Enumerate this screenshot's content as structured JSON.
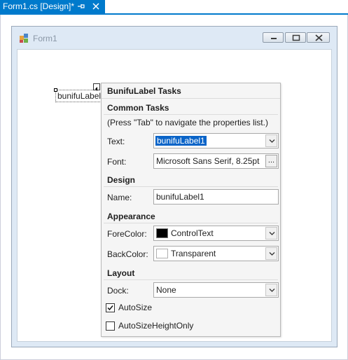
{
  "doc_tab": {
    "label": "Form1.cs [Design]*"
  },
  "form": {
    "title": "Form1"
  },
  "selected_control": {
    "text": "bunifuLabel"
  },
  "tasks": {
    "title": "BunifuLabel Tasks",
    "common": {
      "title": "Common Tasks",
      "hint": "(Press \"Tab\" to navigate the properties list.)",
      "text_label": "Text:",
      "text_value": "bunifuLabel1",
      "font_label": "Font:",
      "font_value": "Microsoft Sans Serif, 8.25pt",
      "font_button": "..."
    },
    "design": {
      "title": "Design",
      "name_label": "Name:",
      "name_value": "bunifuLabel1"
    },
    "appearance": {
      "title": "Appearance",
      "forecolor_label": "ForeColor:",
      "forecolor_value": "ControlText",
      "forecolor_swatch": "#000000",
      "backcolor_label": "BackColor:",
      "backcolor_value": "Transparent",
      "backcolor_swatch": "#ffffff"
    },
    "layout": {
      "title": "Layout",
      "dock_label": "Dock:",
      "dock_value": "None",
      "autosize_label": "AutoSize",
      "autosize_checked": true,
      "autosize_height_label": "AutoSizeHeightOnly",
      "autosize_height_checked": false
    }
  },
  "colors": {
    "accent": "#007acc",
    "selection": "#0a64c8"
  }
}
